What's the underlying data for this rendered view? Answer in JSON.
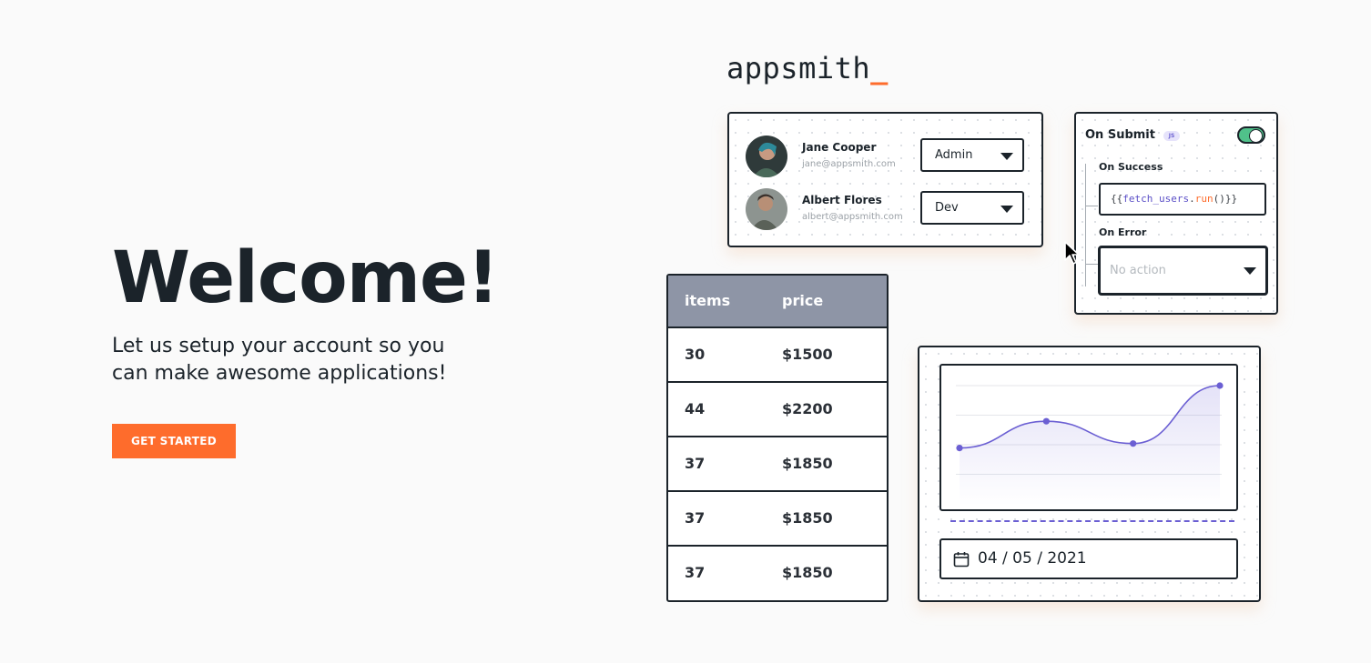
{
  "welcome": {
    "heading": "Welcome!",
    "subtitle": "Let us setup your account so you can make awesome applications!",
    "cta_label": "GET STARTED"
  },
  "logo": {
    "text": "appsmith",
    "suffix": "_"
  },
  "users": [
    {
      "name": "Jane Cooper",
      "email": "jane@appsmith.com",
      "role": "Admin"
    },
    {
      "name": "Albert Flores",
      "email": "albert@appsmith.com",
      "role": "Dev"
    }
  ],
  "event": {
    "title": "On Submit",
    "badge": "JS",
    "on_success_label": "On Success",
    "code_open": "{{",
    "code_fn": "fetch_users",
    "code_dot": ".",
    "code_run": "run",
    "code_close": "()}}",
    "on_error_label": "On Error",
    "action_placeholder": "No action",
    "toggle_on": true
  },
  "table": {
    "headers": [
      "items",
      "price"
    ],
    "rows": [
      [
        "30",
        "$1500"
      ],
      [
        "44",
        "$2200"
      ],
      [
        "37",
        "$1850"
      ],
      [
        "37",
        "$1850"
      ],
      [
        "37",
        "$1850"
      ]
    ]
  },
  "chart": {
    "date_value": "04 / 05 / 2021"
  },
  "chart_data": {
    "type": "area",
    "x": [
      0,
      1,
      2,
      3
    ],
    "values": [
      0.3,
      0.6,
      0.35,
      1.0
    ],
    "series_color": "#6b5fd3"
  },
  "colors": {
    "accent": "#fe6c2c",
    "toggle": "#50c18a",
    "chart": "#6b5fd3",
    "table_header": "#8e95a6"
  }
}
